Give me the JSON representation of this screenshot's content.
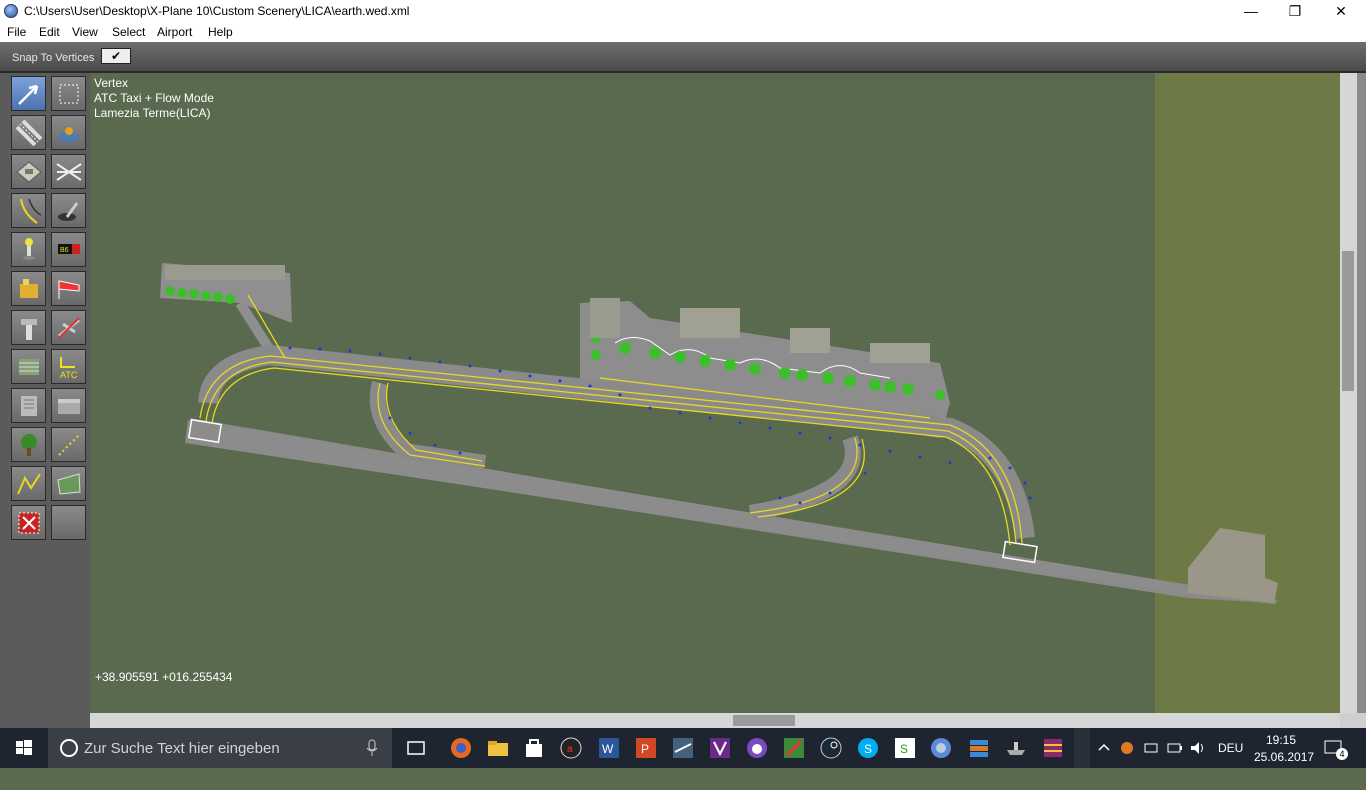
{
  "window": {
    "title": "C:\\Users\\User\\Desktop\\X-Plane 10\\Custom Scenery\\LICA\\earth.wed.xml",
    "minimize": "—",
    "restore": "❐",
    "close": "✕"
  },
  "menu": [
    "File",
    "Edit",
    "View",
    "Select",
    "Airport",
    "Help"
  ],
  "snapbar": {
    "label": "Snap To Vertices",
    "checked": "✔"
  },
  "map": {
    "info_lines": [
      "Vertex",
      "ATC Taxi + Flow Mode",
      "Lamezia Terme(LICA)"
    ],
    "coordinates": "+38.905591 +016.255434"
  },
  "taskbar": {
    "search_placeholder": "Zur Suche Text hier eingeben",
    "language": "DEU",
    "time": "19:15",
    "date": "25.06.2017",
    "notification_count": "4"
  }
}
